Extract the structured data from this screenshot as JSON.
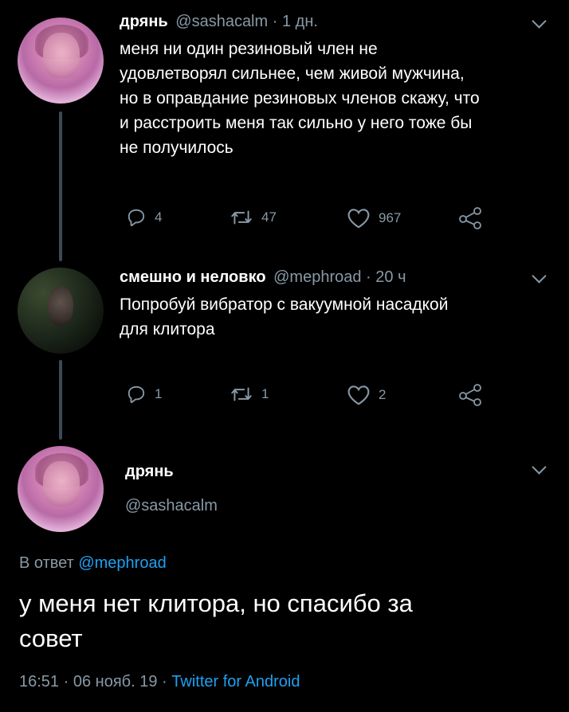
{
  "tweet1": {
    "display_name": "дрянь",
    "handle": "@sashacalm",
    "separator": "·",
    "time": "1 дн.",
    "text_lines": [
      "меня ни один резиновый член не",
      "удовлетворял сильнее, чем живой мужчина,",
      "но в оправдание резиновых членов скажу, что",
      "и расстроить меня так сильно у него тоже бы",
      "не получилось"
    ],
    "replies": "4",
    "retweets": "47",
    "likes": "967"
  },
  "tweet2": {
    "display_name": "смешно и неловко",
    "handle": "@mephroad",
    "separator": "·",
    "time": "20 ч",
    "text_lines": [
      "Попробуй вибратор с вакуумной насадкой",
      "для клитора"
    ],
    "replies": "1",
    "retweets": "1",
    "likes": "2"
  },
  "tweet3": {
    "display_name": "дрянь",
    "handle": "@sashacalm",
    "reply_prefix": "В ответ",
    "reply_to": "@mephroad",
    "text_lines": [
      "у меня нет клитора, но спасибо за",
      "совет"
    ],
    "time": "16:51",
    "sep1": "·",
    "date": "06 нояб. 19",
    "sep2": "·",
    "source": "Twitter for Android"
  },
  "icons": {
    "reply": "reply-icon",
    "retweet": "retweet-icon",
    "like": "heart-icon",
    "share": "share-icon",
    "more": "chevron-down-icon"
  },
  "colors": {
    "background": "#000000",
    "text": "#ffffff",
    "muted": "#8899a6",
    "link": "#1da1f2",
    "thread_line": "#3b4a56"
  }
}
